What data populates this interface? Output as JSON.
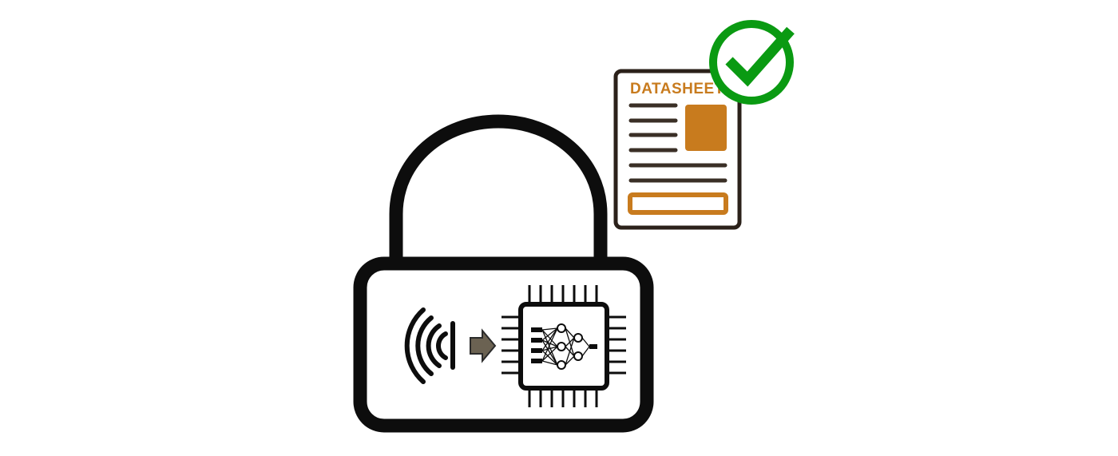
{
  "datasheet": {
    "title": "DATASHEET"
  },
  "colors": {
    "outline": "#0d0d0d",
    "accent_orange": "#c87b1e",
    "check_green": "#0a9a12",
    "doc_line": "#3a2f26",
    "arrow_fill": "#6b6252"
  },
  "icons": {
    "lock": "padlock-icon",
    "signal": "radio-wave-icon",
    "arrow": "arrow-right-icon",
    "chip": "neural-network-chip-icon",
    "document": "datasheet-document-icon",
    "verified": "green-checkmark-icon"
  }
}
